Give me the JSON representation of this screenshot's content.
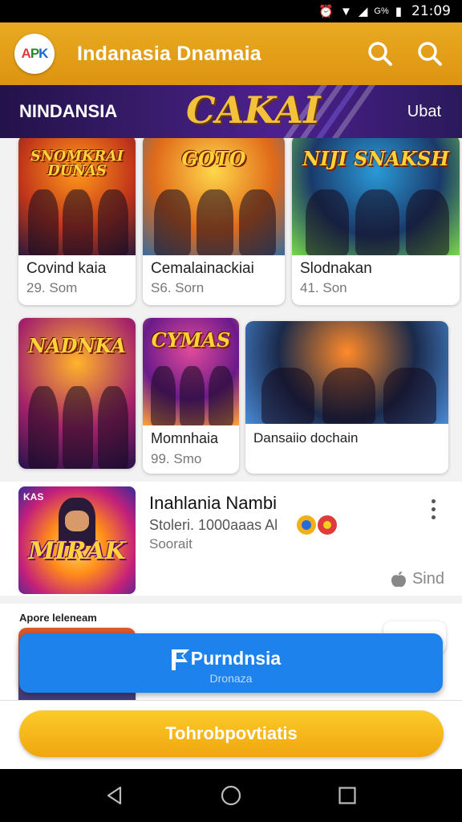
{
  "status_bar": {
    "time": "21:09",
    "network_label": "G%"
  },
  "app": {
    "logo_text": [
      "A",
      "P",
      "K"
    ],
    "title": "Indanasia Dnamaia"
  },
  "banner": {
    "left": "NINDANSIA",
    "center": "CAKAI",
    "right": "Ubat"
  },
  "grid": [
    {
      "art_text": "SNOMKRAI DUNAS",
      "title": "Covind kaia",
      "subtitle": "29. Som",
      "palette": [
        "#ff9a1a",
        "#c2361a",
        "#2a1a3a"
      ]
    },
    {
      "art_text": "GOTO",
      "title": "Cemalainackiai",
      "subtitle": "S6. Sorn",
      "palette": [
        "#ffd84a",
        "#e06a1a",
        "#3a6a9a"
      ]
    },
    {
      "art_text": "NIJI SNAKSH",
      "title": "Slodnakan",
      "subtitle": "41. Son",
      "palette": [
        "#2a9ad8",
        "#1a3a6a",
        "#7ad84a"
      ]
    },
    {
      "art_text": "NADNKA",
      "title": "",
      "subtitle": "",
      "palette": [
        "#ffb42a",
        "#a4226a",
        "#24124a"
      ]
    },
    {
      "art_text": "CYMAS",
      "title": "Momnhaia",
      "subtitle": "99. Smo",
      "palette": [
        "#e04a9a",
        "#6a1a8a",
        "#ffa43a"
      ]
    },
    {
      "art_text": "",
      "title": "Dansaiio dochain",
      "subtitle": "",
      "palette": [
        "#ff8a2a",
        "#1a2a4a",
        "#4a8ad8"
      ]
    }
  ],
  "feature": {
    "art_text": "MIRAK",
    "corner_text": "KAS",
    "title": "Inahlania Nambi",
    "subtitle": "Stoleri. 1000aaas Al",
    "subtitle2": "Soorait",
    "action": "Sind"
  },
  "section": {
    "label": "Apore leleneam"
  },
  "float_button": {
    "label": "Purndnsia",
    "sub": "Dronaza"
  },
  "cta": {
    "label": "Tohrobpovtiatis"
  },
  "colors": {
    "primary": "#e9aa22",
    "accent_blue": "#1e82ec",
    "banner": "#3a1c6e"
  },
  "icons": [
    "search-icon",
    "search-icon",
    "more-vert-icon",
    "back-nav-icon",
    "home-nav-icon",
    "recents-nav-icon"
  ]
}
